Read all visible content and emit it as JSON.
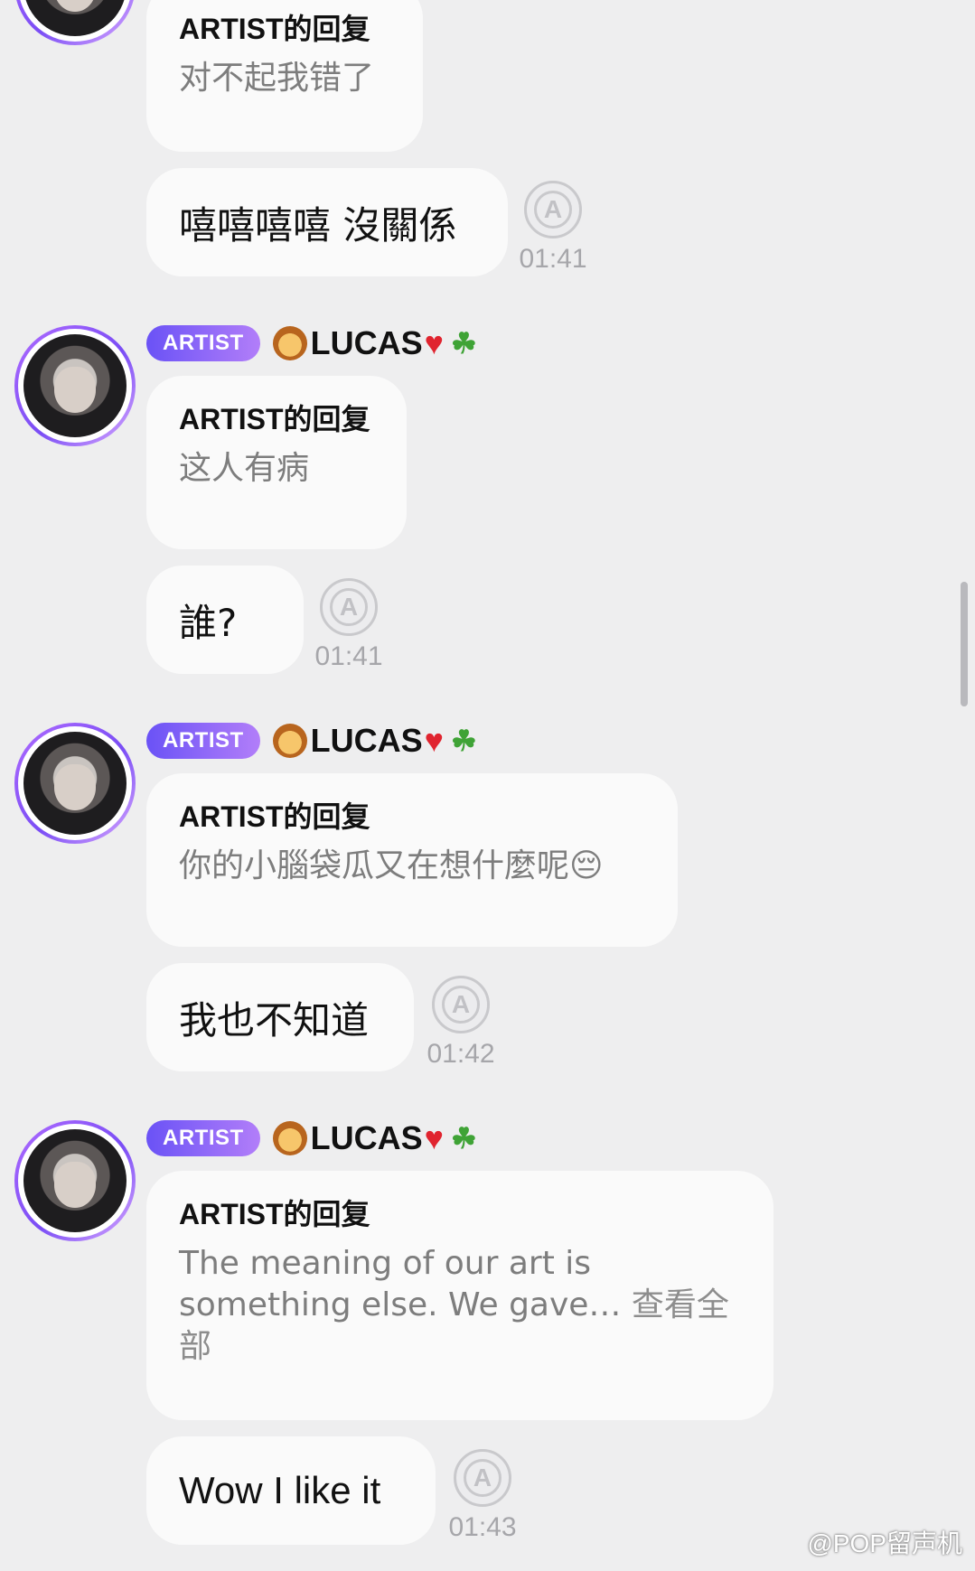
{
  "messages": [
    {
      "reply_header": "ARTIST的回复",
      "reply_text": "对不起我错了",
      "mine": "嘻嘻嘻嘻 沒關係",
      "time": "01:41"
    },
    {
      "badge": "ARTIST",
      "name": "LUCAS",
      "reply_header": "ARTIST的回复",
      "reply_text": "这人有病",
      "mine": "誰?",
      "time": "01:41"
    },
    {
      "badge": "ARTIST",
      "name": "LUCAS",
      "reply_header": "ARTIST的回复",
      "reply_text": "你的小腦袋瓜又在想什麼呢😔",
      "mine": "我也不知道",
      "time": "01:42"
    },
    {
      "badge": "ARTIST",
      "name": "LUCAS",
      "reply_header": "ARTIST的回复",
      "reply_text": "The meaning of our art is something else. We gave…",
      "reply_more": "查看全部",
      "mine": "Wow I like it",
      "time": "01:43"
    }
  ],
  "translate_icon_letter": "A",
  "watermark": "@POP留声机",
  "colors": {
    "background": "#eeeeef",
    "bubble": "#fafafa",
    "badge_start": "#6a52f6",
    "badge_end": "#b27ef9"
  }
}
